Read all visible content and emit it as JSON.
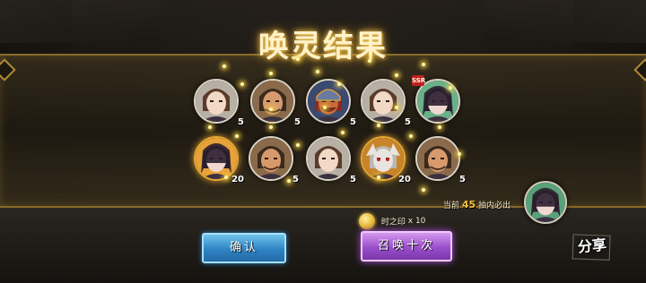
{
  "title": "唤灵结果",
  "heroes": [
    {
      "id": "h1",
      "count": "5",
      "portrait": "female-brown-hair",
      "frame": "silver",
      "skin": "#f2d8c6",
      "hair": "#5a3b2a",
      "bg": "#b8b0a4"
    },
    {
      "id": "h2",
      "count": "5",
      "portrait": "male-warrior-stubble",
      "frame": "silver",
      "skin": "#d79a6c",
      "hair": "#3a2a1e",
      "bg": "#8a6a4a"
    },
    {
      "id": "h3",
      "count": "5",
      "portrait": "armored-general-helmet",
      "frame": "silver",
      "skin": "#c86a3a",
      "hair": "#8a2a20",
      "bg": "#3a4a70"
    },
    {
      "id": "h4",
      "count": "5",
      "portrait": "female-brown-hair",
      "frame": "silver",
      "skin": "#f2d8c6",
      "hair": "#5a3b2a",
      "bg": "#b8b0a4"
    },
    {
      "id": "h5",
      "count": "",
      "portrait": "dark-hair-mage",
      "frame": "silver",
      "skin": "#f0d8d0",
      "hair": "#2a1e2e",
      "bg": "#6ab088",
      "tag": "SSR"
    },
    {
      "id": "h6",
      "count": "20",
      "portrait": "dark-hair-mage",
      "frame": "gold",
      "skin": "#f0d8d0",
      "hair": "#2a1e2e",
      "bg": "#e8a23a"
    },
    {
      "id": "h7",
      "count": "5",
      "portrait": "male-warrior-stubble",
      "frame": "silver",
      "skin": "#d79a6c",
      "hair": "#3a2a1e",
      "bg": "#8a6a4a"
    },
    {
      "id": "h8",
      "count": "5",
      "portrait": "female-brown-hair",
      "frame": "silver",
      "skin": "#f2d8c6",
      "hair": "#5a3b2a",
      "bg": "#b8b0a4"
    },
    {
      "id": "h9",
      "count": "20",
      "portrait": "white-fur-beast",
      "frame": "gold",
      "skin": "#e8e4e0",
      "hair": "#bcb6b0",
      "bg": "#c8842a"
    },
    {
      "id": "h10",
      "count": "5",
      "portrait": "male-warrior-stubble",
      "frame": "silver",
      "skin": "#d79a6c",
      "hair": "#3a2a1e",
      "bg": "#8a6a4a"
    }
  ],
  "notice": {
    "prefix": "当前",
    "number": "45",
    "suffix": "抽内必出"
  },
  "guarantee_portrait": "dark-hair-mage",
  "cost": {
    "label": "时之印",
    "amount": "x 10",
    "icon": "coin-icon"
  },
  "buttons": {
    "confirm": "确认",
    "summon_ten": "召唤十次",
    "share": "分享"
  },
  "colors": {
    "band_border": "#8a6a2a",
    "confirm_blue": "#2f84c4",
    "summon_purple": "#9a4ecb",
    "gold_frame": "#e5a736"
  }
}
